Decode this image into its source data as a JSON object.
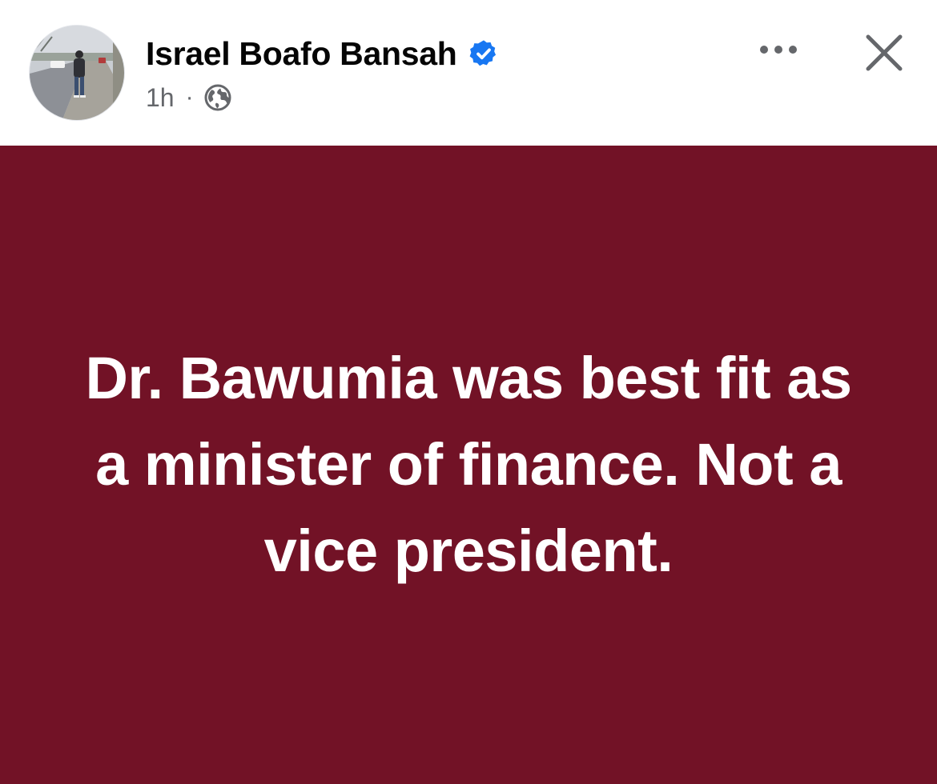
{
  "author": {
    "name": "Israel Boafo Bansah",
    "verified": true
  },
  "meta": {
    "time": "1h",
    "separator": "·",
    "audience_icon": "globe-icon"
  },
  "actions": {
    "more_icon": "more-options-icon",
    "close_icon": "close-icon"
  },
  "post": {
    "text": "Dr. Bawumia was best fit as a minister of finance. Not a vice president."
  },
  "colors": {
    "post_background": "#721226",
    "post_text": "#ffffff",
    "verified_badge": "#1877f2",
    "secondary_text": "#65676b"
  }
}
